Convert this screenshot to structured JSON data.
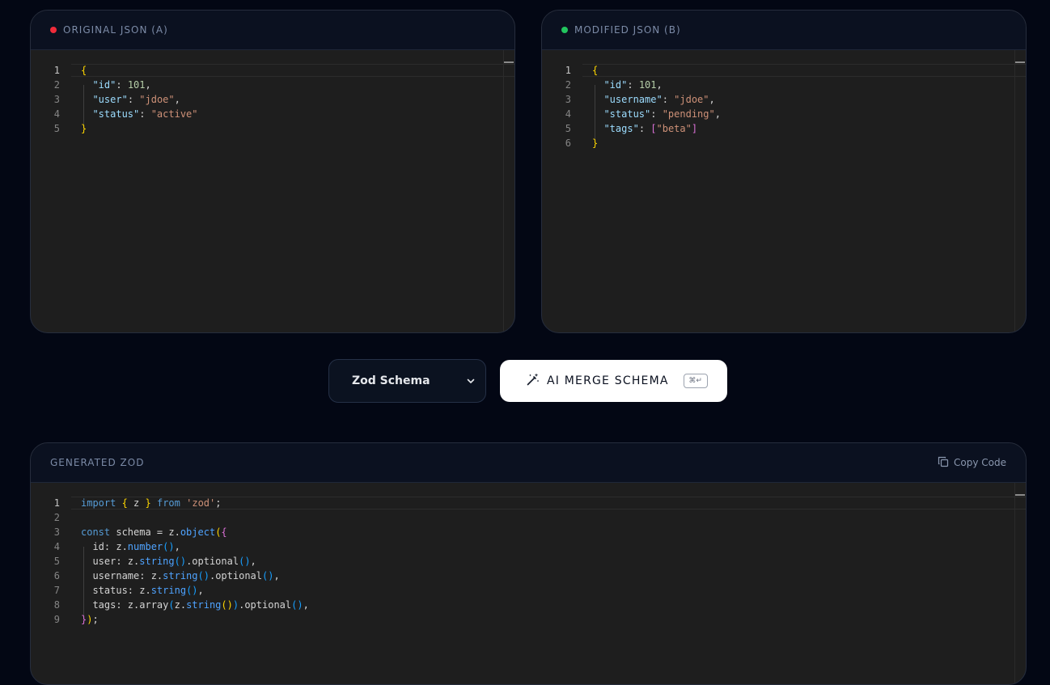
{
  "original": {
    "title": "ORIGINAL JSON (A)",
    "status_color": "#ef2b3a",
    "line_numbers": [
      "1",
      "2",
      "3",
      "4",
      "5"
    ]
  },
  "modified": {
    "title": "MODIFIED JSON (B)",
    "status_color": "#22c55e",
    "line_numbers": [
      "1",
      "2",
      "3",
      "4",
      "5",
      "6"
    ]
  },
  "controls": {
    "schema_select_value": "Zod Schema",
    "merge_button_label": "AI MERGE SCHEMA",
    "shortcut_hint": "⌘↵"
  },
  "output": {
    "title": "GENERATED ZOD",
    "copy_label": "Copy Code",
    "line_numbers": [
      "1",
      "2",
      "3",
      "4",
      "5",
      "6",
      "7",
      "8",
      "9"
    ]
  },
  "icons": {
    "merge": "magic-wand-icon",
    "copy": "copy-icon",
    "select": "chevron-down-icon"
  }
}
